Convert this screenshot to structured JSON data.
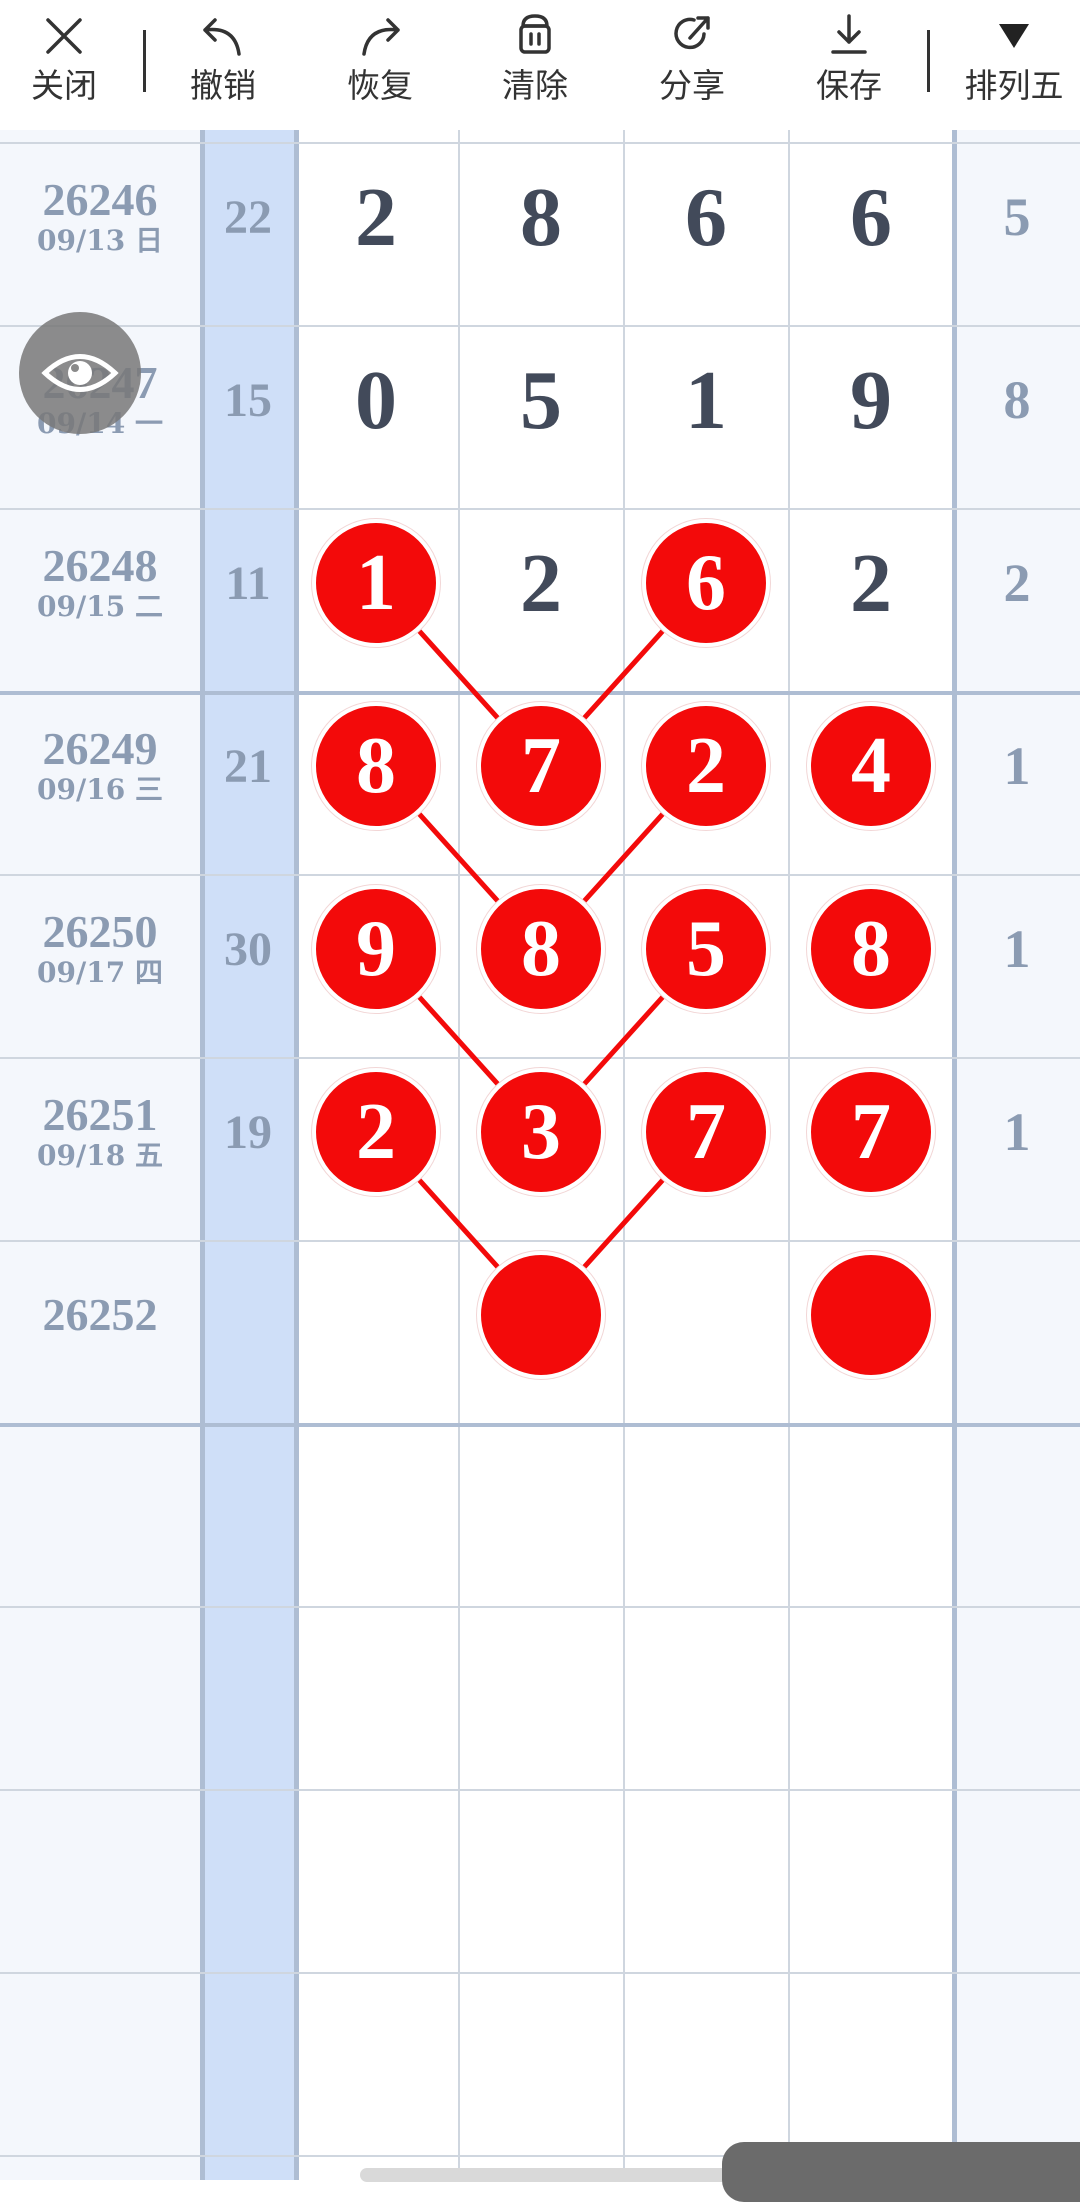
{
  "toolbar": {
    "close": {
      "label": "关闭",
      "icon": "close-icon"
    },
    "undo": {
      "label": "撤销",
      "icon": "undo-icon"
    },
    "redo": {
      "label": "恢复",
      "icon": "redo-icon"
    },
    "clear": {
      "label": "清除",
      "icon": "trash-icon"
    },
    "share": {
      "label": "分享",
      "icon": "share-icon"
    },
    "save": {
      "label": "保存",
      "icon": "download-icon"
    },
    "mode": {
      "label": "排列五",
      "icon": "caret-down-icon"
    }
  },
  "colors": {
    "ball": "#f30a0a",
    "digit": "#424a5a",
    "muted": "#8b9bb2",
    "sum_column": "#cfdff8"
  },
  "rows": [
    {
      "issue": "26246",
      "date": "09/13 日",
      "sum": "22",
      "digits": [
        "2",
        "8",
        "6",
        "6"
      ],
      "r5": "5",
      "balls": []
    },
    {
      "issue": "26247",
      "date": "09/14 一",
      "sum": "15",
      "digits": [
        "0",
        "5",
        "1",
        "9"
      ],
      "r5": "8",
      "balls": []
    },
    {
      "issue": "26248",
      "date": "09/15 二",
      "sum": "11",
      "digits": [
        "1",
        "2",
        "6",
        "2"
      ],
      "r5": "2",
      "balls": [
        0,
        2
      ]
    },
    {
      "issue": "26249",
      "date": "09/16 三",
      "sum": "21",
      "digits": [
        "8",
        "7",
        "2",
        "4"
      ],
      "r5": "1",
      "balls": [
        0,
        1,
        2,
        3
      ]
    },
    {
      "issue": "26250",
      "date": "09/17 四",
      "sum": "30",
      "digits": [
        "9",
        "8",
        "5",
        "8"
      ],
      "r5": "1",
      "balls": [
        0,
        1,
        2,
        3
      ]
    },
    {
      "issue": "26251",
      "date": "09/18 五",
      "sum": "19",
      "digits": [
        "2",
        "3",
        "7",
        "7"
      ],
      "r5": "1",
      "balls": [
        0,
        1,
        2,
        3
      ]
    },
    {
      "issue": "26252",
      "date": "",
      "sum": "",
      "digits": [
        "",
        "",
        "",
        ""
      ],
      "r5": "",
      "balls": [
        1,
        3
      ]
    }
  ],
  "connections": [
    [
      [
        2,
        0
      ],
      [
        3,
        1
      ]
    ],
    [
      [
        2,
        2
      ],
      [
        3,
        1
      ]
    ],
    [
      [
        3,
        0
      ],
      [
        4,
        1
      ]
    ],
    [
      [
        3,
        2
      ],
      [
        4,
        1
      ]
    ],
    [
      [
        4,
        0
      ],
      [
        5,
        1
      ]
    ],
    [
      [
        4,
        2
      ],
      [
        5,
        1
      ]
    ],
    [
      [
        5,
        0
      ],
      [
        6,
        1
      ]
    ],
    [
      [
        5,
        2
      ],
      [
        6,
        1
      ]
    ]
  ],
  "eye_button": {
    "icon": "eye-icon"
  }
}
